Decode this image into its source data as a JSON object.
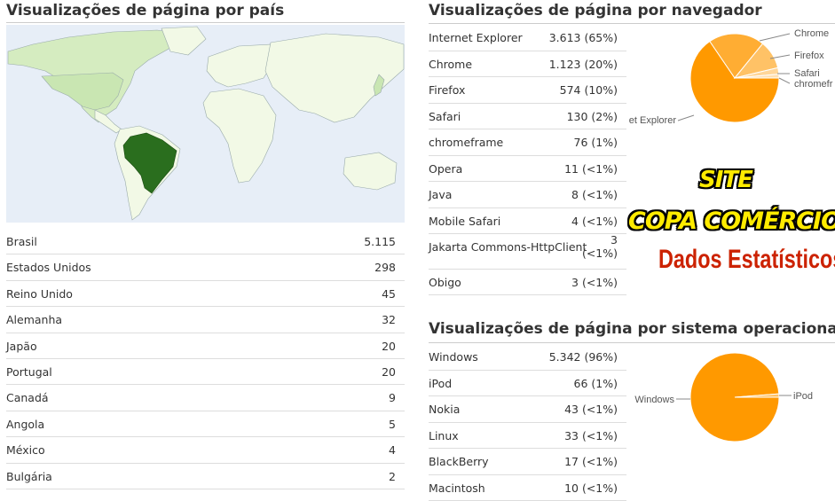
{
  "country": {
    "title": "Visualizações de página por país",
    "rows": [
      {
        "label": "Brasil",
        "value": "5.115"
      },
      {
        "label": "Estados Unidos",
        "value": "298"
      },
      {
        "label": "Reino Unido",
        "value": "45"
      },
      {
        "label": "Alemanha",
        "value": "32"
      },
      {
        "label": "Japão",
        "value": "20"
      },
      {
        "label": "Portugal",
        "value": "20"
      },
      {
        "label": "Canadá",
        "value": "9"
      },
      {
        "label": "Angola",
        "value": "5"
      },
      {
        "label": "México",
        "value": "4"
      },
      {
        "label": "Bulgária",
        "value": "2"
      }
    ],
    "map_colors": {
      "highlight": "#2a6e1e",
      "medium": "#c9e6b2",
      "light": "#f2f9e6",
      "ocean": "#e7eef7"
    }
  },
  "browser": {
    "title": "Visualizações de página por navegador",
    "rows": [
      {
        "label": "Internet Explorer",
        "value": "3.613 (65%)"
      },
      {
        "label": "Chrome",
        "value": "1.123 (20%)"
      },
      {
        "label": "Firefox",
        "value": "574 (10%)"
      },
      {
        "label": "Safari",
        "value": "130 (2%)"
      },
      {
        "label": "chromeframe",
        "value": "76 (1%)"
      },
      {
        "label": "Opera",
        "value": "11 (<1%)"
      },
      {
        "label": "Java",
        "value": "8 (<1%)"
      },
      {
        "label": "Mobile Safari",
        "value": "4 (<1%)"
      },
      {
        "label": "Jakarta Commons-HttpClient",
        "value": "3",
        "value2": "(<1%)"
      },
      {
        "label": "Obigo",
        "value": "3 (<1%)"
      }
    ],
    "pie": {
      "labels": [
        "Chrome",
        "Firefox",
        "Safari",
        "chromefr",
        "et Explorer"
      ],
      "values": [
        3613,
        1123,
        574,
        130,
        76
      ]
    }
  },
  "os": {
    "title": "Visualizações de página por sistema operacional",
    "rows": [
      {
        "label": "Windows",
        "value": "5.342 (96%)"
      },
      {
        "label": "iPod",
        "value": "66 (1%)"
      },
      {
        "label": "Nokia",
        "value": "43 (<1%)"
      },
      {
        "label": "Linux",
        "value": "33 (<1%)"
      },
      {
        "label": "BlackBerry",
        "value": "17 (<1%)"
      },
      {
        "label": "Macintosh",
        "value": "10 (<1%)"
      }
    ],
    "pie": {
      "labels": [
        "Windows",
        "iPod"
      ],
      "values": [
        5342,
        66
      ]
    }
  },
  "promo": {
    "line1": "SITE",
    "line2": "COPA COMÉRCIO",
    "line3": "Dados Estatísticos"
  },
  "chart_colors": {
    "main": "#ff9900",
    "second": "#ffad33",
    "third": "#ffc266",
    "fourth": "#ffd699",
    "fifth": "#ffe0b3",
    "edge": "#ffffff"
  }
}
